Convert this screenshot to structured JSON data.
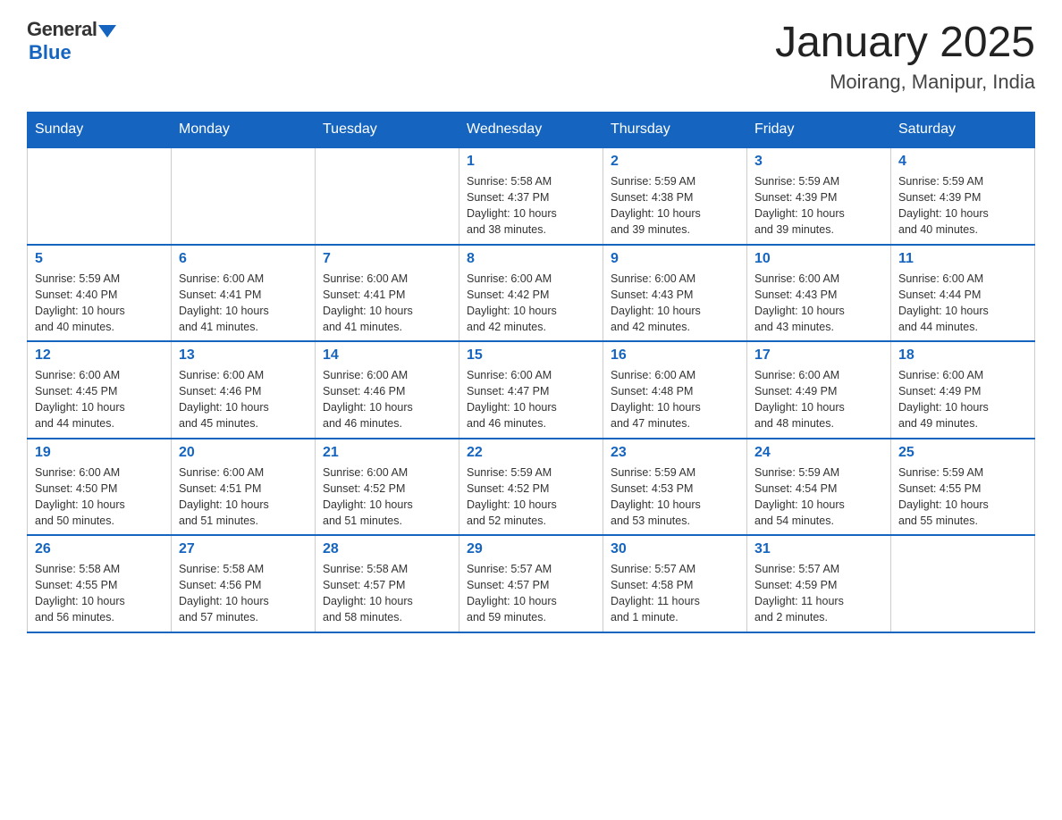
{
  "header": {
    "logo_general": "General",
    "logo_blue": "Blue",
    "month_title": "January 2025",
    "location": "Moirang, Manipur, India"
  },
  "days_of_week": [
    "Sunday",
    "Monday",
    "Tuesday",
    "Wednesday",
    "Thursday",
    "Friday",
    "Saturday"
  ],
  "weeks": [
    [
      {
        "day": "",
        "info": ""
      },
      {
        "day": "",
        "info": ""
      },
      {
        "day": "",
        "info": ""
      },
      {
        "day": "1",
        "info": "Sunrise: 5:58 AM\nSunset: 4:37 PM\nDaylight: 10 hours\nand 38 minutes."
      },
      {
        "day": "2",
        "info": "Sunrise: 5:59 AM\nSunset: 4:38 PM\nDaylight: 10 hours\nand 39 minutes."
      },
      {
        "day": "3",
        "info": "Sunrise: 5:59 AM\nSunset: 4:39 PM\nDaylight: 10 hours\nand 39 minutes."
      },
      {
        "day": "4",
        "info": "Sunrise: 5:59 AM\nSunset: 4:39 PM\nDaylight: 10 hours\nand 40 minutes."
      }
    ],
    [
      {
        "day": "5",
        "info": "Sunrise: 5:59 AM\nSunset: 4:40 PM\nDaylight: 10 hours\nand 40 minutes."
      },
      {
        "day": "6",
        "info": "Sunrise: 6:00 AM\nSunset: 4:41 PM\nDaylight: 10 hours\nand 41 minutes."
      },
      {
        "day": "7",
        "info": "Sunrise: 6:00 AM\nSunset: 4:41 PM\nDaylight: 10 hours\nand 41 minutes."
      },
      {
        "day": "8",
        "info": "Sunrise: 6:00 AM\nSunset: 4:42 PM\nDaylight: 10 hours\nand 42 minutes."
      },
      {
        "day": "9",
        "info": "Sunrise: 6:00 AM\nSunset: 4:43 PM\nDaylight: 10 hours\nand 42 minutes."
      },
      {
        "day": "10",
        "info": "Sunrise: 6:00 AM\nSunset: 4:43 PM\nDaylight: 10 hours\nand 43 minutes."
      },
      {
        "day": "11",
        "info": "Sunrise: 6:00 AM\nSunset: 4:44 PM\nDaylight: 10 hours\nand 44 minutes."
      }
    ],
    [
      {
        "day": "12",
        "info": "Sunrise: 6:00 AM\nSunset: 4:45 PM\nDaylight: 10 hours\nand 44 minutes."
      },
      {
        "day": "13",
        "info": "Sunrise: 6:00 AM\nSunset: 4:46 PM\nDaylight: 10 hours\nand 45 minutes."
      },
      {
        "day": "14",
        "info": "Sunrise: 6:00 AM\nSunset: 4:46 PM\nDaylight: 10 hours\nand 46 minutes."
      },
      {
        "day": "15",
        "info": "Sunrise: 6:00 AM\nSunset: 4:47 PM\nDaylight: 10 hours\nand 46 minutes."
      },
      {
        "day": "16",
        "info": "Sunrise: 6:00 AM\nSunset: 4:48 PM\nDaylight: 10 hours\nand 47 minutes."
      },
      {
        "day": "17",
        "info": "Sunrise: 6:00 AM\nSunset: 4:49 PM\nDaylight: 10 hours\nand 48 minutes."
      },
      {
        "day": "18",
        "info": "Sunrise: 6:00 AM\nSunset: 4:49 PM\nDaylight: 10 hours\nand 49 minutes."
      }
    ],
    [
      {
        "day": "19",
        "info": "Sunrise: 6:00 AM\nSunset: 4:50 PM\nDaylight: 10 hours\nand 50 minutes."
      },
      {
        "day": "20",
        "info": "Sunrise: 6:00 AM\nSunset: 4:51 PM\nDaylight: 10 hours\nand 51 minutes."
      },
      {
        "day": "21",
        "info": "Sunrise: 6:00 AM\nSunset: 4:52 PM\nDaylight: 10 hours\nand 51 minutes."
      },
      {
        "day": "22",
        "info": "Sunrise: 5:59 AM\nSunset: 4:52 PM\nDaylight: 10 hours\nand 52 minutes."
      },
      {
        "day": "23",
        "info": "Sunrise: 5:59 AM\nSunset: 4:53 PM\nDaylight: 10 hours\nand 53 minutes."
      },
      {
        "day": "24",
        "info": "Sunrise: 5:59 AM\nSunset: 4:54 PM\nDaylight: 10 hours\nand 54 minutes."
      },
      {
        "day": "25",
        "info": "Sunrise: 5:59 AM\nSunset: 4:55 PM\nDaylight: 10 hours\nand 55 minutes."
      }
    ],
    [
      {
        "day": "26",
        "info": "Sunrise: 5:58 AM\nSunset: 4:55 PM\nDaylight: 10 hours\nand 56 minutes."
      },
      {
        "day": "27",
        "info": "Sunrise: 5:58 AM\nSunset: 4:56 PM\nDaylight: 10 hours\nand 57 minutes."
      },
      {
        "day": "28",
        "info": "Sunrise: 5:58 AM\nSunset: 4:57 PM\nDaylight: 10 hours\nand 58 minutes."
      },
      {
        "day": "29",
        "info": "Sunrise: 5:57 AM\nSunset: 4:57 PM\nDaylight: 10 hours\nand 59 minutes."
      },
      {
        "day": "30",
        "info": "Sunrise: 5:57 AM\nSunset: 4:58 PM\nDaylight: 11 hours\nand 1 minute."
      },
      {
        "day": "31",
        "info": "Sunrise: 5:57 AM\nSunset: 4:59 PM\nDaylight: 11 hours\nand 2 minutes."
      },
      {
        "day": "",
        "info": ""
      }
    ]
  ]
}
